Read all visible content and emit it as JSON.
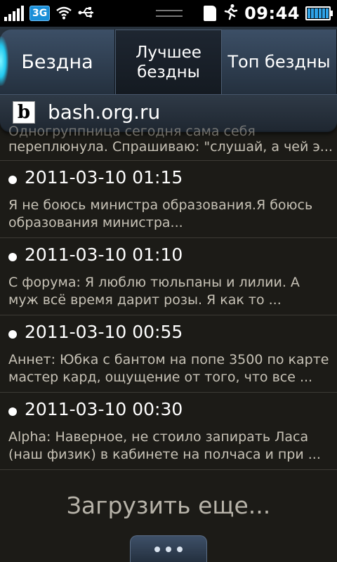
{
  "status_bar": {
    "network": "3G",
    "time": "09:44",
    "icons": [
      "signal-icon",
      "3g-icon",
      "wifi-icon",
      "usb-icon",
      "sd-card-icon",
      "running-icon",
      "battery-icon"
    ]
  },
  "tabs": [
    {
      "label": "Бездна"
    },
    {
      "label": "Лучшее бездны",
      "selected": true
    },
    {
      "label": "Топ бездны"
    }
  ],
  "site": {
    "favicon_letter": "b",
    "url": "bash.org.ru"
  },
  "partial_item": {
    "line1": "Одногруппница сегодня сама себя",
    "line2": "переплюнула. Спрашиваю: \"слушай, а чей э..."
  },
  "items": [
    {
      "date": "2011-03-10 01:15",
      "line1": "Я не боюсь министра образования.Я боюсь",
      "line2": "образования министра..."
    },
    {
      "date": "2011-03-10 01:10",
      "line1": "С форума: Я люблю тюльпаны и лилии. А",
      "line2": "муж всё время дарит розы. Я как то ..."
    },
    {
      "date": "2011-03-10 00:55",
      "line1": "Аннет: Юбка с бантом на попе 3500 по карте",
      "line2": "мастер кард, ощущение от того, что все ..."
    },
    {
      "date": "2011-03-10 00:30",
      "line1": "Alpha: Наверное, не стоило запирать Ласа",
      "line2": "(наш физик) в кабинете на полчаса и при ..."
    }
  ],
  "load_more_label": "Загрузить еще...",
  "colors": {
    "accent": "#1a8fd8",
    "tab_bg": "#2f3f52",
    "list_bg": "#1c1b17",
    "text_secondary": "#c7c2b6"
  }
}
